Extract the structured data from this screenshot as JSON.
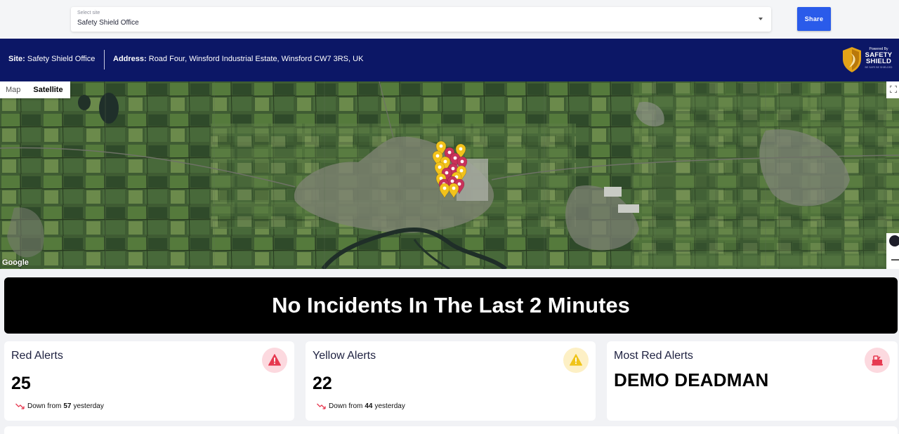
{
  "site_select": {
    "label": "Select site",
    "value": "Safety Shield Office",
    "caret_icon": "chevron-down-icon"
  },
  "share_label": "Share",
  "info": {
    "site_label": "Site:",
    "site_value": "Safety Shield Office",
    "address_label": "Address:",
    "address_value": "Road Four, Winsford Industrial Estate, Winsford CW7 3RS, UK"
  },
  "brand": {
    "powered_by": "Powered By",
    "name_line1": "SAFETY",
    "name_line2": "SHIELD",
    "tagline": "BE SAFE BE SHIELDED",
    "logo_icon": "shield-logo-icon"
  },
  "map": {
    "tabs": [
      "Map",
      "Satellite"
    ],
    "active_tab": "Satellite",
    "attribution": "Google",
    "marker_colors": {
      "red": "#c8325a",
      "yellow": "#f2c21b"
    }
  },
  "banner": {
    "message": "No Incidents In The Last 2 Minutes"
  },
  "cards": {
    "red": {
      "title": "Red Alerts",
      "value": "25",
      "trend_prefix": "Down from",
      "trend_value": "57",
      "trend_suffix": "yesterday",
      "icon": "warning-triangle-icon",
      "color": "#e63950"
    },
    "yellow": {
      "title": "Yellow Alerts",
      "value": "22",
      "trend_prefix": "Down from",
      "trend_value": "44",
      "trend_suffix": "yesterday",
      "icon": "warning-triangle-icon",
      "color": "#f0c419"
    },
    "most": {
      "title": "Most Red Alerts",
      "value": "DEMO DEADMAN",
      "icon": "vehicle-icon",
      "color": "#e63950"
    }
  },
  "colors": {
    "navy": "#0c1766",
    "share_blue": "#2a5bea",
    "trend_red": "#e63950"
  }
}
